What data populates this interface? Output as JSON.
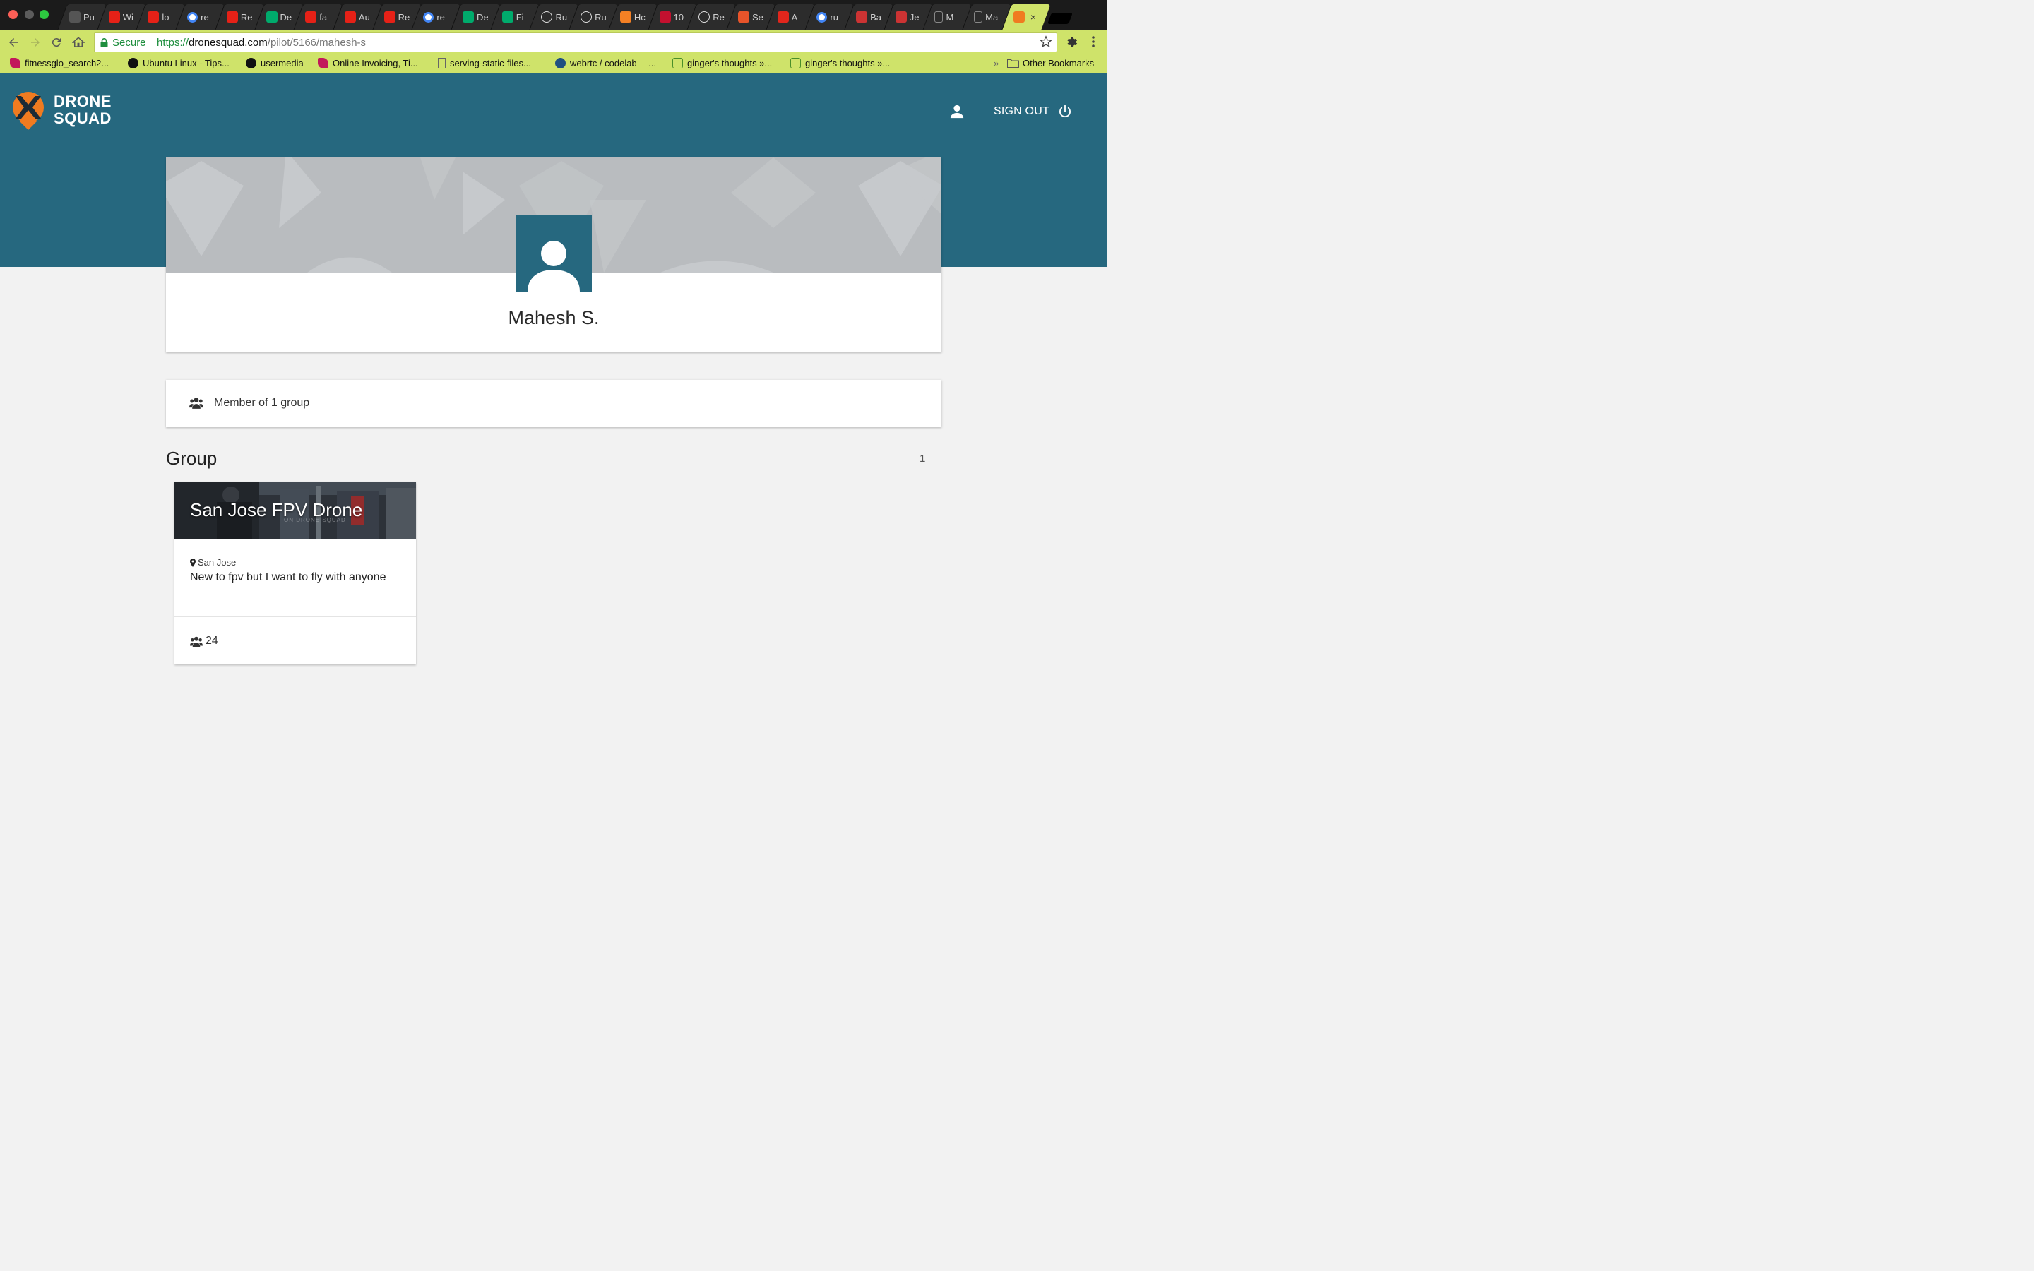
{
  "browser": {
    "tabs": [
      {
        "label": "Pu",
        "icon": "apple-icon",
        "color": "#555555"
      },
      {
        "label": "Wi",
        "icon": "youtube-icon",
        "color": "#e62117"
      },
      {
        "label": "lo",
        "icon": "youtube-icon",
        "color": "#e62117"
      },
      {
        "label": "re",
        "icon": "google-icon",
        "color": "#ffffff"
      },
      {
        "label": "Re",
        "icon": "youtube-icon",
        "color": "#e62117"
      },
      {
        "label": "De",
        "icon": "medium-icon",
        "color": "#00ab6c"
      },
      {
        "label": "fa",
        "icon": "youtube-icon",
        "color": "#e62117"
      },
      {
        "label": "Au",
        "icon": "youtube-icon",
        "color": "#e62117"
      },
      {
        "label": "Re",
        "icon": "youtube-icon",
        "color": "#e62117"
      },
      {
        "label": "re",
        "icon": "google-icon",
        "color": "#ffffff"
      },
      {
        "label": "De",
        "icon": "medium-icon",
        "color": "#00ab6c"
      },
      {
        "label": "Fi",
        "icon": "medium-icon",
        "color": "#00ab6c"
      },
      {
        "label": "Ru",
        "icon": "react-icon",
        "color": "#dddddd"
      },
      {
        "label": "Ru",
        "icon": "react-icon",
        "color": "#dddddd"
      },
      {
        "label": "Hc",
        "icon": "stackoverflow-icon",
        "color": "#f48024"
      },
      {
        "label": "10",
        "icon": "dr-icon",
        "color": "#c4102f"
      },
      {
        "label": "Re",
        "icon": "mask-icon",
        "color": "#dddddd"
      },
      {
        "label": "Se",
        "icon": "plus-icon",
        "color": "#e8542a"
      },
      {
        "label": "A",
        "icon": "s-icon",
        "color": "#e1261c"
      },
      {
        "label": "ru",
        "icon": "google-icon",
        "color": "#ffffff"
      },
      {
        "label": "Ba",
        "icon": "pen-icon",
        "color": "#cc3333"
      },
      {
        "label": "Je",
        "icon": "pen-icon",
        "color": "#cc3333"
      },
      {
        "label": "M",
        "icon": "page-icon",
        "color": "#888888"
      },
      {
        "label": "Ma",
        "icon": "page-icon",
        "color": "#888888"
      },
      {
        "label": "",
        "icon": "dronesquad-icon",
        "color": "#f07b20",
        "active": true
      }
    ],
    "secure_label": "Secure",
    "url_scheme": "https://",
    "url_host": "dronesquad.com",
    "url_path": "/pilot/5166/mahesh-s",
    "bookmarks": [
      {
        "label": "fitnessglo_search2...",
        "icon": "leaf-icon"
      },
      {
        "label": "Ubuntu Linux - Tips...",
        "icon": "ubuntu-icon"
      },
      {
        "label": "usermedia",
        "icon": "github-icon"
      },
      {
        "label": "Online Invoicing, Ti...",
        "icon": "leaf-icon"
      },
      {
        "label": "serving-static-files...",
        "icon": "page-icon"
      },
      {
        "label": "webrtc / codelab —...",
        "icon": "bitbucket-icon"
      },
      {
        "label": "ginger's thoughts »...",
        "icon": "speech-icon"
      },
      {
        "label": "ginger's thoughts »...",
        "icon": "speech-icon"
      }
    ],
    "more_bookmarks": "»",
    "other_bookmarks": "Other Bookmarks"
  },
  "site": {
    "logo_line1": "DRONE",
    "logo_line2": "SQUAD",
    "sign_out_label": "SIGN OUT",
    "brand_color": "#26687f",
    "accent_color": "#f07b20"
  },
  "profile": {
    "name": "Mahesh S.",
    "membership_text": "Member of 1 group"
  },
  "groups_section": {
    "title": "Group",
    "count": "1",
    "items": [
      {
        "name": "San Jose FPV Drone",
        "banner_watermark": "ON DRONE SQUAD",
        "location": "San Jose",
        "description": "New to fpv but I want to fly with anyone",
        "members": "24"
      }
    ]
  }
}
